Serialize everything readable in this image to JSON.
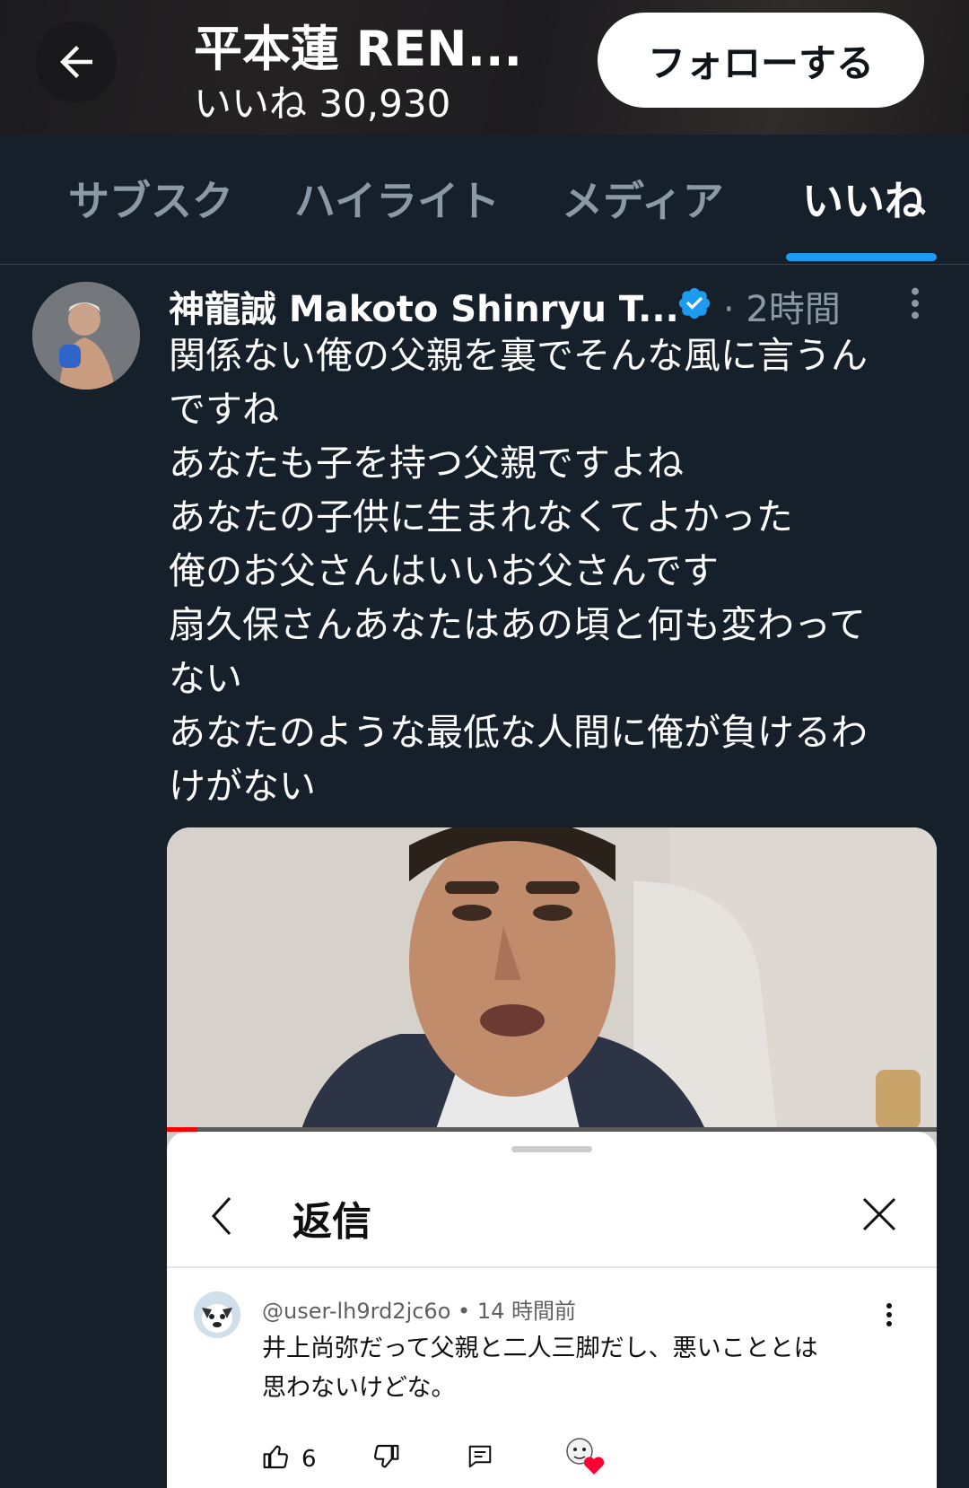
{
  "header": {
    "title": "平本蓮 REN...",
    "subtitle": "いいね 30,930",
    "follow_label": "フォローする"
  },
  "tabs": [
    {
      "label": "サブスク",
      "active": false
    },
    {
      "label": "ハイライト",
      "active": false
    },
    {
      "label": "メディア",
      "active": false
    },
    {
      "label": "いいね",
      "active": true
    }
  ],
  "tweet": {
    "author": "神龍誠 Makoto Shinryu T...",
    "verified": true,
    "time": "· 2時間",
    "text": "関係ない俺の父親を裏でそんな風に言うん\nですね\nあなたも子を持つ父親ですよね\nあなたの子供に生まれなくてよかった\n俺のお父さんはいいお父さんです\n扇久保さんあなたはあの頃と何も変わって\nない\nあなたのような最低な人間に俺が負けるわ\nけがない"
  },
  "video": {
    "progress": 0.04
  },
  "reply_sheet": {
    "title": "返信",
    "comment": {
      "user": "@user-lh9rd2jc6o",
      "time": "14 時間前",
      "text": "井上尚弥だって父親と二人三脚だし、悪いこととは\n思わないけどな。",
      "likes": "6"
    }
  },
  "colors": {
    "background": "#15202b",
    "accent": "#1d9bf0",
    "muted": "#8b98a5",
    "heart": "#ff0033"
  }
}
